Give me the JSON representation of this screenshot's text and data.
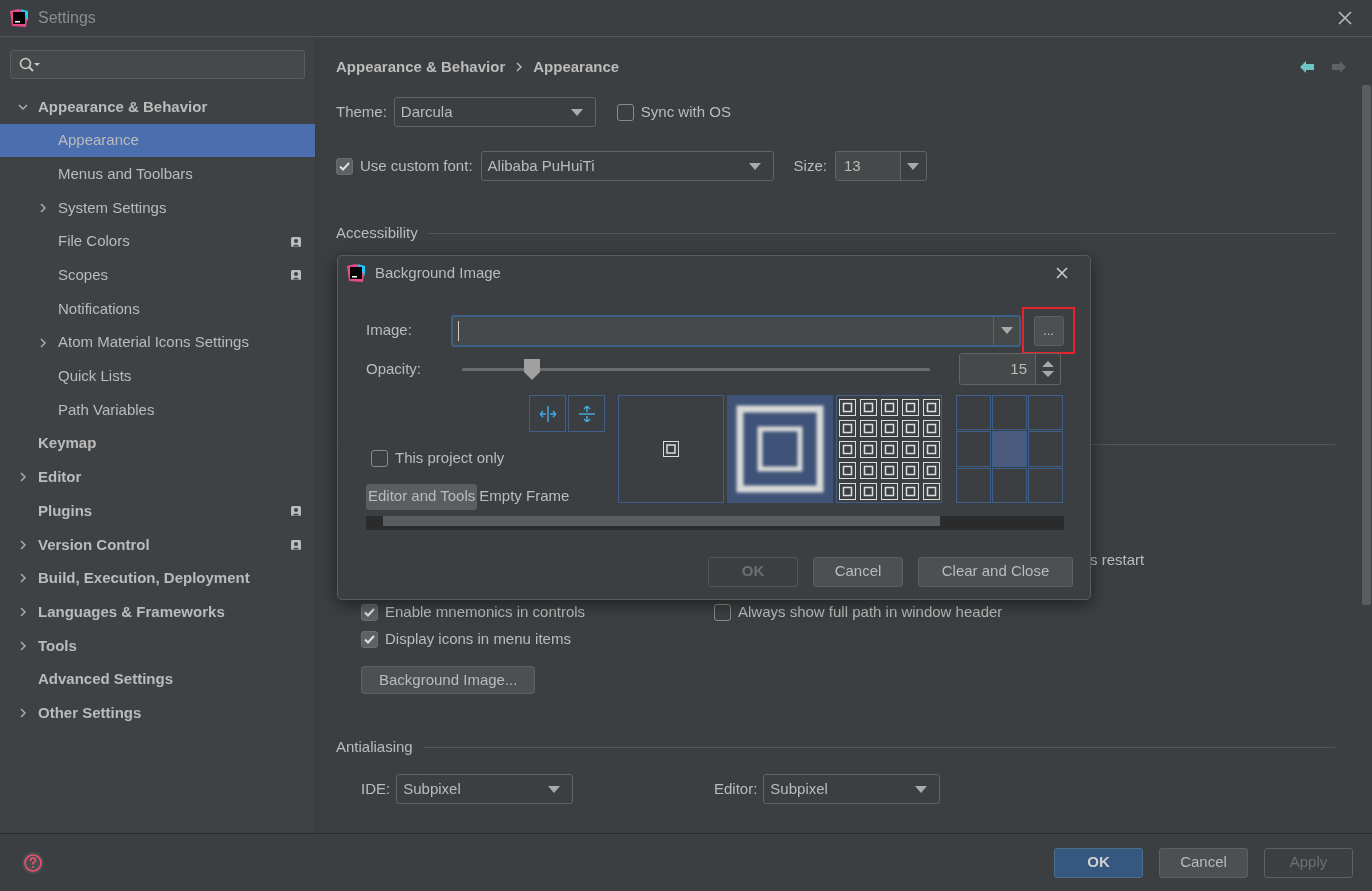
{
  "window": {
    "title": "Settings"
  },
  "sidebar": {
    "items": [
      {
        "label": "Appearance & Behavior",
        "kind": "group",
        "expanded": true,
        "children": [
          {
            "label": "Appearance",
            "kind": "leaf",
            "selected": true
          },
          {
            "label": "Menus and Toolbars",
            "kind": "leaf",
            "selected": false
          },
          {
            "label": "System Settings",
            "kind": "group",
            "expanded": false,
            "selected": false
          },
          {
            "label": "File Colors",
            "kind": "leaf",
            "selected": false,
            "badge": true
          },
          {
            "label": "Scopes",
            "kind": "leaf",
            "selected": false,
            "badge": true
          },
          {
            "label": "Notifications",
            "kind": "leaf",
            "selected": false
          },
          {
            "label": "Atom Material Icons Settings",
            "kind": "group",
            "expanded": false,
            "selected": false
          },
          {
            "label": "Quick Lists",
            "kind": "leaf",
            "selected": false
          },
          {
            "label": "Path Variables",
            "kind": "leaf",
            "selected": false
          }
        ]
      },
      {
        "label": "Keymap",
        "kind": "leaf",
        "selected": false
      },
      {
        "label": "Editor",
        "kind": "group",
        "expanded": false,
        "selected": false
      },
      {
        "label": "Plugins",
        "kind": "leaf",
        "selected": false,
        "badge": true
      },
      {
        "label": "Version Control",
        "kind": "group",
        "expanded": false,
        "selected": false,
        "badge": true
      },
      {
        "label": "Build, Execution, Deployment",
        "kind": "group",
        "expanded": false,
        "selected": false
      },
      {
        "label": "Languages & Frameworks",
        "kind": "group",
        "expanded": false,
        "selected": false
      },
      {
        "label": "Tools",
        "kind": "group",
        "expanded": false,
        "selected": false
      },
      {
        "label": "Advanced Settings",
        "kind": "leaf",
        "selected": false
      },
      {
        "label": "Other Settings",
        "kind": "group",
        "expanded": false,
        "selected": false
      }
    ]
  },
  "breadcrumb": [
    "Appearance & Behavior",
    "Appearance"
  ],
  "theme": {
    "label": "Theme:",
    "value": "Darcula"
  },
  "sync_with_os": {
    "label": "Sync with OS",
    "checked": false
  },
  "custom_font": {
    "label": "Use custom font:",
    "checked": true,
    "value": "Alibaba PuHuiTi"
  },
  "size": {
    "label": "Size:",
    "value": "13"
  },
  "accessibility_heading": "Accessibility",
  "restart_fragment": "s restart",
  "options": [
    {
      "label": "Enable mnemonics in controls",
      "checked": true
    },
    {
      "label": "Always show full path in window header",
      "checked": false
    },
    {
      "label": "Display icons in menu items",
      "checked": true
    }
  ],
  "background_image_button": "Background Image...",
  "antialiasing": {
    "heading": "Antialiasing",
    "ide": {
      "label": "IDE:",
      "value": "Subpixel"
    },
    "editor": {
      "label": "Editor:",
      "value": "Subpixel"
    }
  },
  "dialog": {
    "title": "Background Image",
    "image_label": "Image:",
    "browse_button": "...",
    "opacity_label": "Opacity:",
    "opacity": {
      "level": 0.15,
      "value": "15"
    },
    "fill_modes": [
      {
        "kind": "center",
        "selected": false
      },
      {
        "kind": "scale",
        "selected": true
      },
      {
        "kind": "tile",
        "selected": false
      }
    ],
    "anchors": [
      {
        "selected": false
      },
      {
        "selected": false
      },
      {
        "selected": false
      },
      {
        "selected": false
      },
      {
        "selected": true
      },
      {
        "selected": false
      },
      {
        "selected": false
      },
      {
        "selected": false
      },
      {
        "selected": false
      }
    ],
    "this_project_only": {
      "label": "This project only",
      "checked": false
    },
    "targets": [
      {
        "label": "Editor and Tools",
        "selected": true
      },
      {
        "label": "Empty Frame",
        "selected": false
      }
    ],
    "buttons": [
      {
        "label": "OK",
        "disabled": true
      },
      {
        "label": "Cancel",
        "disabled": false
      },
      {
        "label": "Clear and Close",
        "disabled": false
      }
    ]
  },
  "footer_buttons": [
    {
      "label": "OK",
      "kind": "primary",
      "disabled": false
    },
    {
      "label": "Cancel",
      "kind": "normal",
      "disabled": false
    },
    {
      "label": "Apply",
      "kind": "normal",
      "disabled": true
    }
  ]
}
